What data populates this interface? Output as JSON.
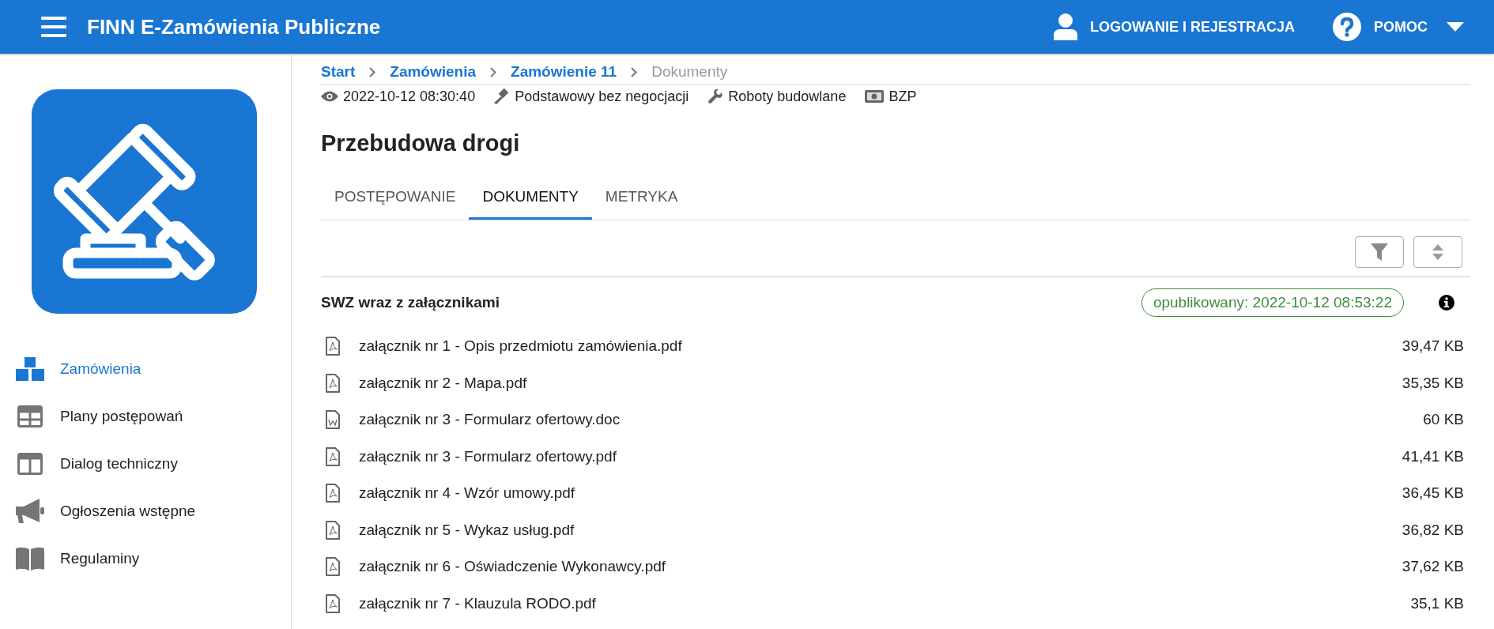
{
  "header": {
    "title": "FINN E-Zamówienia Publiczne",
    "login": "LOGOWANIE I REJESTRACJA",
    "help": "POMOC"
  },
  "sidebar": {
    "items": [
      {
        "label": "Zamówienia",
        "selected": true
      },
      {
        "label": "Plany postępowań",
        "selected": false
      },
      {
        "label": "Dialog techniczny",
        "selected": false
      },
      {
        "label": "Ogłoszenia wstępne",
        "selected": false
      },
      {
        "label": "Regulaminy",
        "selected": false
      }
    ]
  },
  "breadcrumb": [
    {
      "label": "Start",
      "current": false
    },
    {
      "label": "Zamówienia",
      "current": false
    },
    {
      "label": "Zamówienie 11",
      "current": false
    },
    {
      "label": "Dokumenty",
      "current": true
    }
  ],
  "meta": [
    {
      "kind": "date",
      "text": "2022-10-12 08:30:40"
    },
    {
      "kind": "mode",
      "text": "Podstawowy bez negocjacji"
    },
    {
      "kind": "type",
      "text": "Roboty budowlane"
    },
    {
      "kind": "money",
      "text": "BZP"
    }
  ],
  "title": "Przebudowa drogi",
  "tabs": [
    {
      "label": "POSTĘPOWANIE",
      "selected": false
    },
    {
      "label": "DOKUMENTY",
      "selected": true
    },
    {
      "label": "METRYKA",
      "selected": false
    }
  ],
  "section": {
    "title": "SWZ wraz z załącznikami",
    "status": "opublikowany: 2022-10-12 08:53:22"
  },
  "files": [
    {
      "kind": "pdf",
      "name": "załącznik nr 1 - Opis przedmiotu zamówienia.pdf",
      "size": "39,47 KB"
    },
    {
      "kind": "pdf",
      "name": "załącznik nr 2 - Mapa.pdf",
      "size": "35,35 KB"
    },
    {
      "kind": "doc",
      "name": "załącznik nr 3 - Formularz ofertowy.doc",
      "size": "60 KB"
    },
    {
      "kind": "pdf",
      "name": "załącznik nr 3 - Formularz ofertowy.pdf",
      "size": "41,41 KB"
    },
    {
      "kind": "pdf",
      "name": "załącznik nr 4 - Wzór umowy.pdf",
      "size": "36,45 KB"
    },
    {
      "kind": "pdf",
      "name": "załącznik nr 5 - Wykaz usług.pdf",
      "size": "36,82 KB"
    },
    {
      "kind": "pdf",
      "name": "załącznik nr 6 - Oświadczenie Wykonawcy.pdf",
      "size": "37,62 KB"
    },
    {
      "kind": "pdf",
      "name": "załącznik nr 7 - Klauzula RODO.pdf",
      "size": "35,1 KB"
    }
  ]
}
